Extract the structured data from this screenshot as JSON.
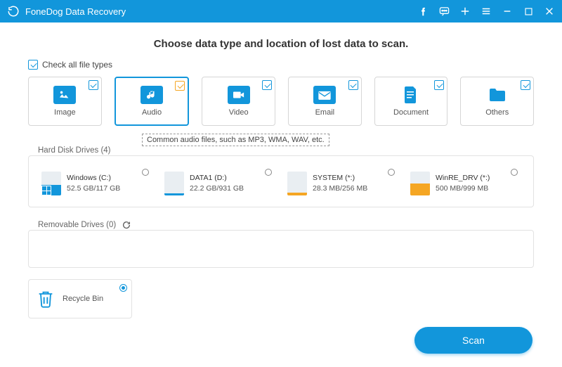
{
  "app": {
    "title": "FoneDog Data Recovery"
  },
  "heading": "Choose data type and location of lost data to scan.",
  "checkall_label": "Check all file types",
  "types": {
    "image": {
      "label": "Image"
    },
    "audio": {
      "label": "Audio",
      "tooltip": "Common audio files, such as MP3, WMA, WAV, etc."
    },
    "video": {
      "label": "Video"
    },
    "email": {
      "label": "Email"
    },
    "document": {
      "label": "Document"
    },
    "others": {
      "label": "Others"
    }
  },
  "hard_drives": {
    "label": "Hard Disk Drives (4)",
    "items": [
      {
        "name": "Windows (C:)",
        "size": "52.5 GB/117 GB",
        "fill_pct": 45,
        "color": "blue",
        "win_badge": true
      },
      {
        "name": "DATA1 (D:)",
        "size": "22.2 GB/931 GB",
        "fill_pct": 8,
        "color": "blue"
      },
      {
        "name": "SYSTEM (*:)",
        "size": "28.3 MB/256 MB",
        "fill_pct": 12,
        "color": "orange"
      },
      {
        "name": "WinRE_DRV (*:)",
        "size": "500 MB/999 MB",
        "fill_pct": 50,
        "color": "orange"
      }
    ]
  },
  "removable": {
    "label": "Removable Drives (0)"
  },
  "recycle": {
    "label": "Recycle Bin"
  },
  "scan_label": "Scan"
}
